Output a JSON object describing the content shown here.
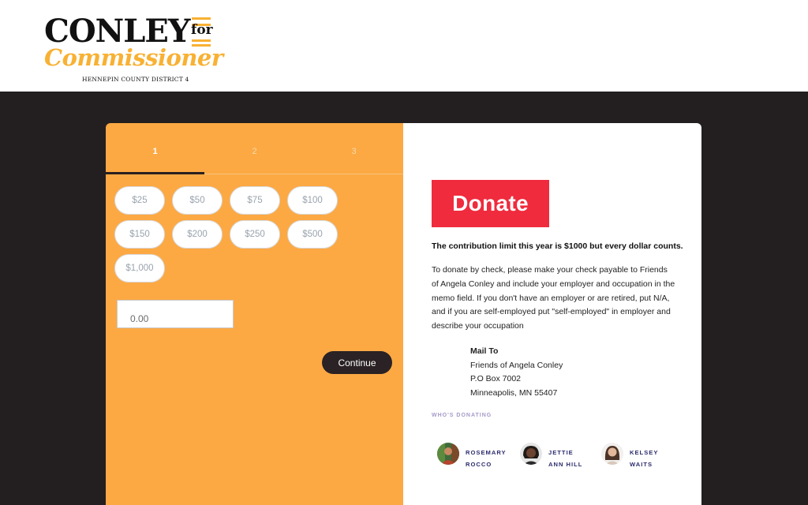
{
  "header": {
    "logo_name": "CONLEY",
    "logo_for": "for",
    "logo_script": "Commissioner",
    "logo_sub": "HENNEPIN COUNTY DISTRICT 4",
    "logo_accent": "#f8b133"
  },
  "steps": {
    "labels": [
      "1",
      "2",
      "3"
    ],
    "active": 1
  },
  "amounts": [
    "$25",
    "$50",
    "$75",
    "$100",
    "$150",
    "$200",
    "$250",
    "$500",
    "$1,000"
  ],
  "custom_amount": {
    "value": "0.00"
  },
  "continue_label": "Continue",
  "donate": {
    "heading": "Donate",
    "limit_text": "The contribution limit this year is $1000 but every dollar counts.",
    "check_text": "To donate by check, please make your check payable to Friends of Angela Conley and include your employer and occupation in the memo field. If you don't have an employer or are retired, put N/A, and if you are self-employed put \"self-employed\" in employer and describe your occupation",
    "mail_label": "Mail To",
    "mail_lines": [
      "Friends of Angela Conley",
      "P.O Box 7002",
      "Minneapolis, MN 55407"
    ],
    "accent": "#ef2b3d"
  },
  "donors": {
    "heading": "WHO'S DONATING",
    "people": [
      {
        "line1": "ROSEMARY",
        "line2": "ROCCO"
      },
      {
        "line1": "JETTIE",
        "line2": "ANN HILL"
      },
      {
        "line1": "KELSEY",
        "line2": "WAITS"
      }
    ]
  },
  "colors": {
    "panel_orange": "#fca944",
    "dark_background": "#231f20",
    "donor_name": "#2c2c6e"
  }
}
